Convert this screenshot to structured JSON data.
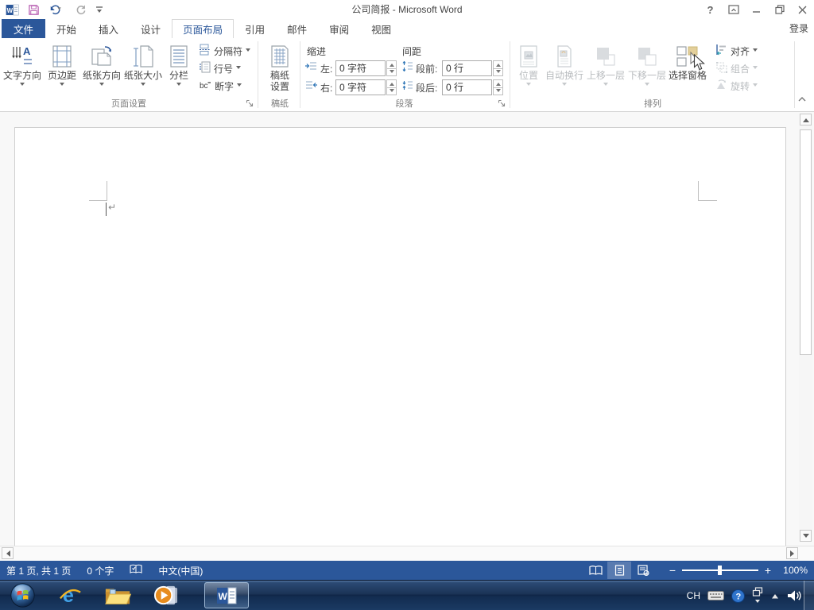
{
  "window": {
    "title": "公司简报 - Microsoft Word",
    "help_glyph": "?",
    "sign_in": "登录"
  },
  "tabs": {
    "file": "文件",
    "items": [
      "开始",
      "插入",
      "设计",
      "页面布局",
      "引用",
      "邮件",
      "审阅",
      "视图"
    ]
  },
  "ribbon": {
    "page_setup": {
      "label": "页面设置",
      "buttons": [
        "文字方向",
        "页边距",
        "纸张方向",
        "纸张大小",
        "分栏"
      ],
      "small_buttons": [
        "分隔符",
        "行号",
        "断字"
      ],
      "hyphenation_glyph": "bc",
      "text_direction_glyph": "A"
    },
    "manuscript": {
      "label": "稿纸",
      "button": "稿纸设置"
    },
    "paragraph": {
      "label": "段落",
      "indent_header": "缩进",
      "spacing_header": "间距",
      "left_label": "左:",
      "right_label": "右:",
      "before_label": "段前:",
      "after_label": "段后:",
      "left_value": "0 字符",
      "right_value": "0 字符",
      "before_value": "0 行",
      "after_value": "0 行"
    },
    "arrange": {
      "label": "排列",
      "buttons": [
        "位置",
        "自动换行",
        "上移一层",
        "下移一层",
        "选择窗格"
      ],
      "small_buttons": [
        "对齐",
        "组合",
        "旋转"
      ]
    }
  },
  "document": {
    "paragraph_mark": "↵"
  },
  "status_bar": {
    "page_info": "第 1 页, 共 1 页",
    "word_count": "0 个字",
    "language": "中文(中国)",
    "zoom_out": "−",
    "zoom_in": "+",
    "zoom_level": "100%"
  },
  "taskbar": {
    "tray_language": "CH",
    "word_logo_glyph": "W",
    "tray_help_glyph": "?"
  },
  "colors": {
    "accent": "#2b579a",
    "status_bar": "#2b579a",
    "disabled_text": "#b9bcbf"
  }
}
